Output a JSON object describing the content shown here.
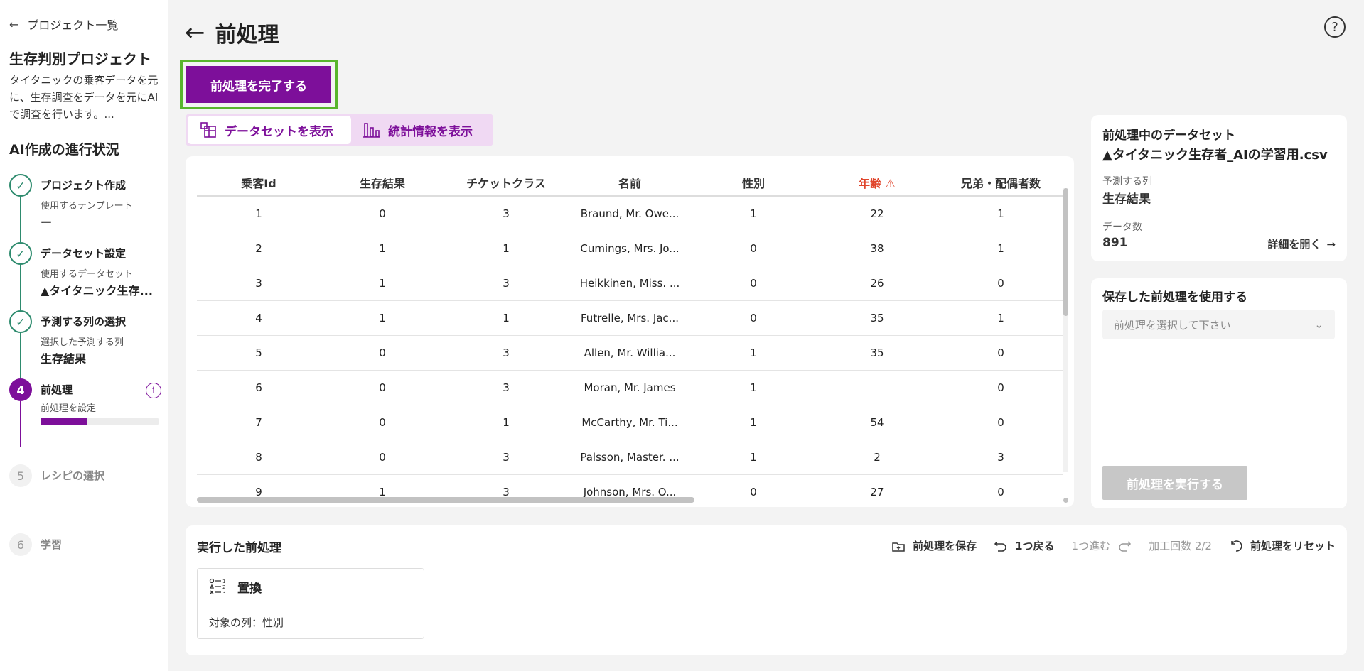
{
  "sidebar": {
    "back_label": "プロジェクト一覧",
    "project_title": "生存判別プロジェクト",
    "project_desc": "タイタニックの乗客データを元に、生存調査をデータを元にAIで調査を行います。...",
    "progress_title": "AI作成の進行状況",
    "steps": [
      {
        "num": "1",
        "title": "プロジェクト作成",
        "sub": "使用するテンプレート",
        "value": "ー",
        "status": "done"
      },
      {
        "num": "2",
        "title": "データセット設定",
        "sub": "使用するデータセット",
        "value": "▲タイタニック生存...",
        "status": "done"
      },
      {
        "num": "3",
        "title": "予測する列の選択",
        "sub": "選択した予測する列",
        "value": "生存結果",
        "status": "done"
      },
      {
        "num": "4",
        "title": "前処理",
        "sub": "前処理を設定",
        "progress": 0.4,
        "status": "active"
      },
      {
        "num": "5",
        "title": "レシピの選択",
        "status": "todo"
      },
      {
        "num": "6",
        "title": "学習",
        "status": "todo"
      }
    ]
  },
  "header": {
    "title": "前処理",
    "complete_label": "前処理を完了する"
  },
  "view_toggle": {
    "dataset_label": "データセットを表示",
    "stats_label": "統計情報を表示"
  },
  "table": {
    "columns": [
      "乗客Id",
      "生存結果",
      "チケットクラス",
      "名前",
      "性別",
      "年齢",
      "兄弟・配偶者数"
    ],
    "rows": [
      [
        "1",
        "0",
        "3",
        "Braund, Mr. Owe...",
        "1",
        "22",
        "1"
      ],
      [
        "2",
        "1",
        "1",
        "Cumings, Mrs. Jo...",
        "0",
        "38",
        "1"
      ],
      [
        "3",
        "1",
        "3",
        "Heikkinen, Miss. ...",
        "0",
        "26",
        "0"
      ],
      [
        "4",
        "1",
        "1",
        "Futrelle, Mrs. Jac...",
        "0",
        "35",
        "1"
      ],
      [
        "5",
        "0",
        "3",
        "Allen, Mr. Willia...",
        "1",
        "35",
        "0"
      ],
      [
        "6",
        "0",
        "3",
        "Moran, Mr. James",
        "1",
        "",
        "0"
      ],
      [
        "7",
        "0",
        "1",
        "McCarthy, Mr. Ti...",
        "1",
        "54",
        "0"
      ],
      [
        "8",
        "0",
        "3",
        "Palsson, Master. ...",
        "1",
        "2",
        "3"
      ],
      [
        "9",
        "1",
        "3",
        "Johnson, Mrs. O...",
        "0",
        "27",
        "0"
      ]
    ]
  },
  "dataset_card": {
    "heading": "前処理中のデータセット",
    "name": "▲タイタニック生存者_AIの学習用.csv",
    "target_label": "予測する列",
    "target_value": "生存結果",
    "count_label": "データ数",
    "count_value": "891",
    "details_link": "詳細を開く"
  },
  "saved_card": {
    "heading": "保存した前処理を使用する",
    "select_placeholder": "前処理を選択して下さい",
    "run_label": "前処理を実行する"
  },
  "executed": {
    "heading": "実行した前処理",
    "save_label": "前処理を保存",
    "undo_label": "1つ戻る",
    "redo_label": "1つ進む",
    "count_label": "加工回数 2/2",
    "reset_label": "前処理をリセット",
    "operations": [
      {
        "title": "置換",
        "target": "対象の列：性別"
      }
    ]
  },
  "colors": {
    "accent": "#7d0f9a",
    "done": "#2e8b6e",
    "highlight": "#58b52c",
    "warning": "#e0452c"
  }
}
